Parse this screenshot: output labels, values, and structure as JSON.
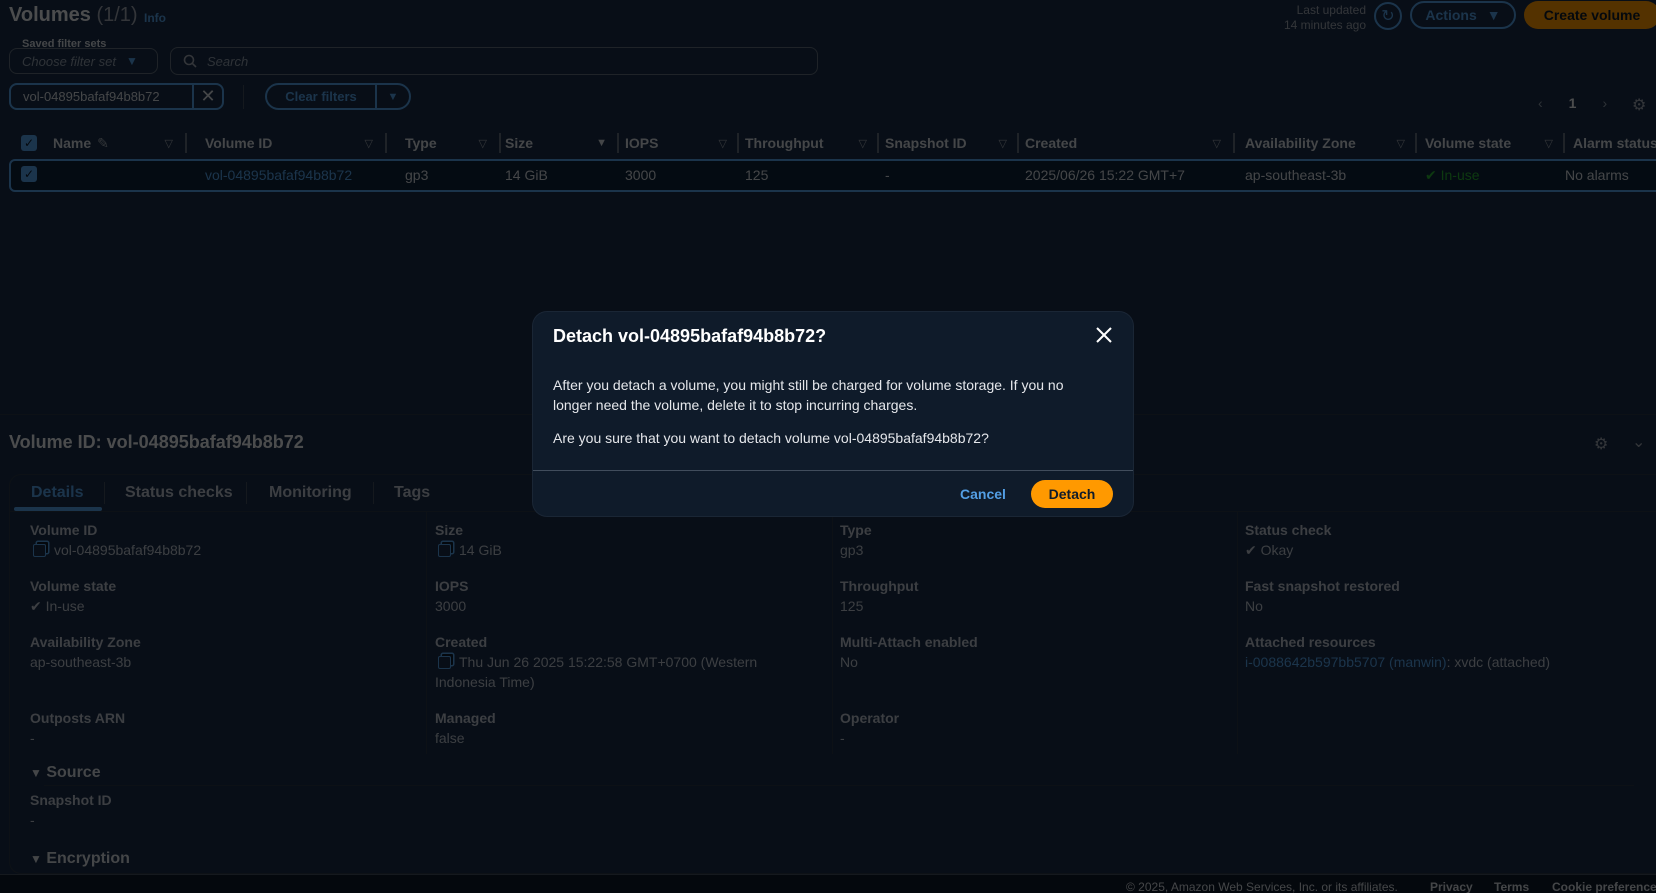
{
  "header": {
    "title": "Volumes",
    "count": "(1/1)",
    "info": "Info",
    "last_updated_label": "Last updated",
    "last_updated_value": "14 minutes ago",
    "actions_label": "Actions",
    "create_label": "Create volume"
  },
  "filters": {
    "saved_sets_label": "Saved filter sets",
    "saved_sets_placeholder": "Choose filter set",
    "search_placeholder": "Search",
    "token": "vol-04895bafaf94b8b72",
    "clear_label": "Clear filters"
  },
  "pager": {
    "page": "1"
  },
  "table": {
    "columns": [
      "Name",
      "Volume ID",
      "Type",
      "Size",
      "IOPS",
      "Throughput",
      "Snapshot ID",
      "Created",
      "Availability Zone",
      "Volume state",
      "Alarm status"
    ],
    "row": {
      "name": "",
      "volume_id": "vol-04895bafaf94b8b72",
      "type": "gp3",
      "size": "14 GiB",
      "iops": "3000",
      "throughput": "125",
      "snapshot_id": "-",
      "created": "2025/06/26 15:22 GMT+7",
      "az": "ap-southeast-3b",
      "state": "In-use",
      "alarm": "No alarms"
    }
  },
  "detail": {
    "title": "Volume ID: vol-04895bafaf94b8b72",
    "tabs": [
      "Details",
      "Status checks",
      "Monitoring",
      "Tags"
    ],
    "fields": {
      "volume_id_label": "Volume ID",
      "volume_id": "vol-04895bafaf94b8b72",
      "size_label": "Size",
      "size": "14 GiB",
      "type_label": "Type",
      "type": "gp3",
      "status_check_label": "Status check",
      "status_check": "Okay",
      "state_label": "Volume state",
      "state": "In-use",
      "iops_label": "IOPS",
      "iops": "3000",
      "throughput_label": "Throughput",
      "throughput": "125",
      "fast_snap_label": "Fast snapshot restored",
      "fast_snap": "No",
      "az_label": "Availability Zone",
      "az": "ap-southeast-3b",
      "created_label": "Created",
      "created": "Thu Jun 26 2025 15:22:58 GMT+0700 (Western Indonesia Time)",
      "multi_attach_label": "Multi-Attach enabled",
      "multi_attach": "No",
      "attached_label": "Attached resources",
      "attached_instance": "i-0088642b597bb5707 (manwin)",
      "attached_suffix": ": xvdc (attached)",
      "outposts_label": "Outposts ARN",
      "outposts": "-",
      "managed_label": "Managed",
      "managed": "false",
      "operator_label": "Operator",
      "operator": "-"
    },
    "source_label": "Source",
    "snapshot_label": "Snapshot ID",
    "snapshot": "-",
    "encryption_label": "Encryption"
  },
  "footer": {
    "copyright": "© 2025, Amazon Web Services, Inc. or its affiliates.",
    "privacy": "Privacy",
    "terms": "Terms",
    "cookies": "Cookie preferences"
  },
  "modal": {
    "title": "Detach vol-04895bafaf94b8b72?",
    "body1": "After you detach a volume, you might still be charged for volume storage. If you no longer need the volume, delete it to stop incurring charges.",
    "body2": "Are you sure that you want to detach volume vol-04895bafaf94b8b72?",
    "cancel": "Cancel",
    "confirm": "Detach"
  },
  "colors": {
    "accent": "#539fe5",
    "primary": "#ff9900",
    "success": "#29ad32",
    "bg": "#0f1b2a"
  }
}
